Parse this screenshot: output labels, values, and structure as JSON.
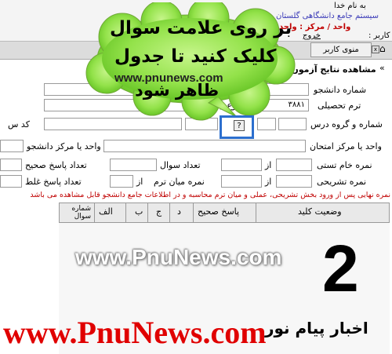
{
  "header": {
    "greeting": "به نام خدا",
    "system_title": "سیستم جامع دانشگاهی گلستان",
    "unit_label": "واحد / مرکز : واحد",
    "user_label": "کاربر :",
    "exit_label": "خروج"
  },
  "tabs": {
    "user_menu": "منوی کاربر",
    "results": "مشاهده نتایج آزمون دانشجو"
  },
  "callout": {
    "line1": "بر روی علامت سوال",
    "line2": "کلیک کنید تا جدول",
    "url": "www.pnunews.com",
    "line3": "ظاهر شود"
  },
  "form": {
    "student_number": "شماره دانشجو",
    "term": "ترم تحصیلی",
    "term_value": "۳۸۸۱",
    "registration_type": "نوع ثبت نام",
    "course_group": "شماره و گروه درس",
    "code": "کد س",
    "exam_unit": "واحد یا مرکز امتحان",
    "student_unit": "واحد یا مرکز دانشجو",
    "test_score": "نمره خام تستی",
    "from1": "از",
    "question_count": "تعداد سوال",
    "correct_count": "تعداد پاسخ صحیح",
    "descriptive_score": "نمره تشریحی",
    "from2": "از",
    "midterm_score": "نمره میان ترم",
    "from3": "از",
    "wrong_count": "تعداد پاسخ غلط",
    "help_glyph": "?",
    "notice": "نمره نهایی پس از ورود بخش تشریحی، عملی و میان ترم محاسبه و در اطلاعات جامع دانشجو قابل مشاهده می باشد"
  },
  "table": {
    "headers": [
      "وضعیت کلید",
      "پاسخ صحیح",
      "د",
      "ج",
      "ب",
      "الف",
      "شماره سوال"
    ]
  },
  "overlays": {
    "watermark_mid": "www.PnuNews.com",
    "big_number": "2",
    "watermark_bottom": "www.PnuNews.com",
    "news_label": "اخبار پیام نور"
  }
}
